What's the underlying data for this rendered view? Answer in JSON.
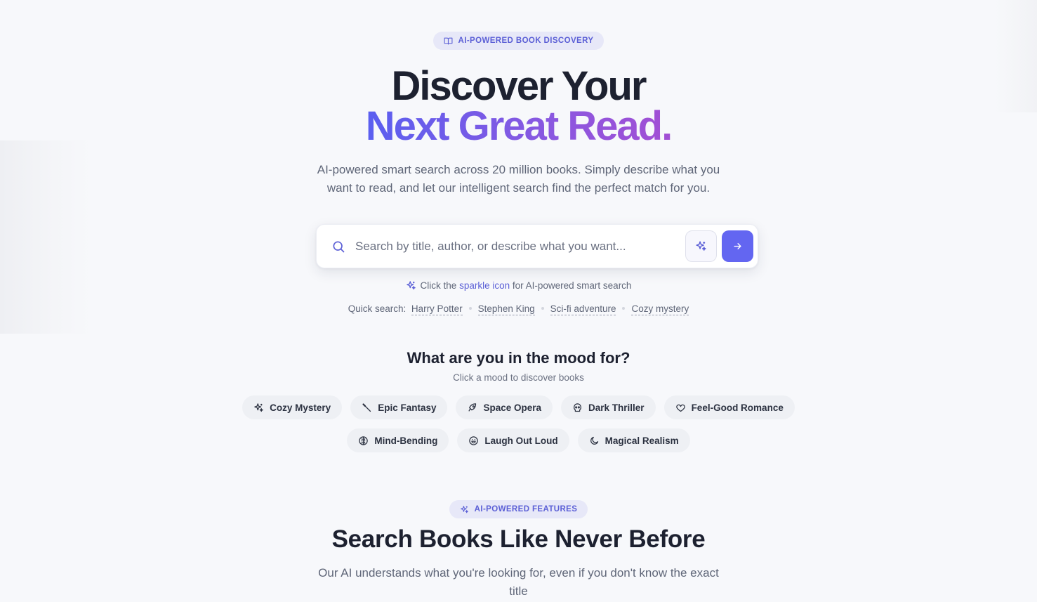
{
  "badge": {
    "label": "AI-POWERED BOOK DISCOVERY",
    "icon": "book-open-icon"
  },
  "hero": {
    "title_line1": "Discover Your",
    "title_line2": "Next Great Read.",
    "subtitle_line1": "AI-powered smart search across 20 million books. Simply describe what you",
    "subtitle_line2": "want to read, and let our intelligent search find the perfect match for you."
  },
  "search": {
    "placeholder": "Search by title, author, or describe what you want...",
    "value": "",
    "icons": {
      "search": "search-icon",
      "ai": "sparkle-icon",
      "submit": "arrow-right-icon"
    }
  },
  "hint": {
    "before": "Click the",
    "accent": "sparkle icon",
    "after": "for AI-powered smart search"
  },
  "quick_search": {
    "label": "Quick search:",
    "items": [
      "Harry Potter",
      "Stephen King",
      "Sci-fi adventure",
      "Cozy mystery"
    ]
  },
  "mood": {
    "title": "What are you in the mood for?",
    "subtitle": "Click a mood to discover books",
    "row1": [
      {
        "label": "Cozy Mystery",
        "icon": "sparkles-icon"
      },
      {
        "label": "Epic Fantasy",
        "icon": "wand-icon"
      },
      {
        "label": "Space Opera",
        "icon": "rocket-icon"
      },
      {
        "label": "Dark Thriller",
        "icon": "skull-icon"
      },
      {
        "label": "Feel-Good Romance",
        "icon": "heart-icon"
      }
    ],
    "row2": [
      {
        "label": "Mind-Bending",
        "icon": "brain-icon"
      },
      {
        "label": "Laugh Out Loud",
        "icon": "laugh-icon"
      },
      {
        "label": "Magical Realism",
        "icon": "moon-icon"
      }
    ]
  },
  "features": {
    "badge": "AI-POWERED FEATURES",
    "title": "Search Books Like Never Before",
    "subtitle_line1": "Our AI understands what you're looking for, even if you don't know the exact",
    "subtitle_line2": "title"
  },
  "colors": {
    "accent": "#6366f1",
    "accent_text": "#5b5fd6",
    "gradient_start": "#5a5ff0",
    "gradient_end": "#a24fd4"
  }
}
